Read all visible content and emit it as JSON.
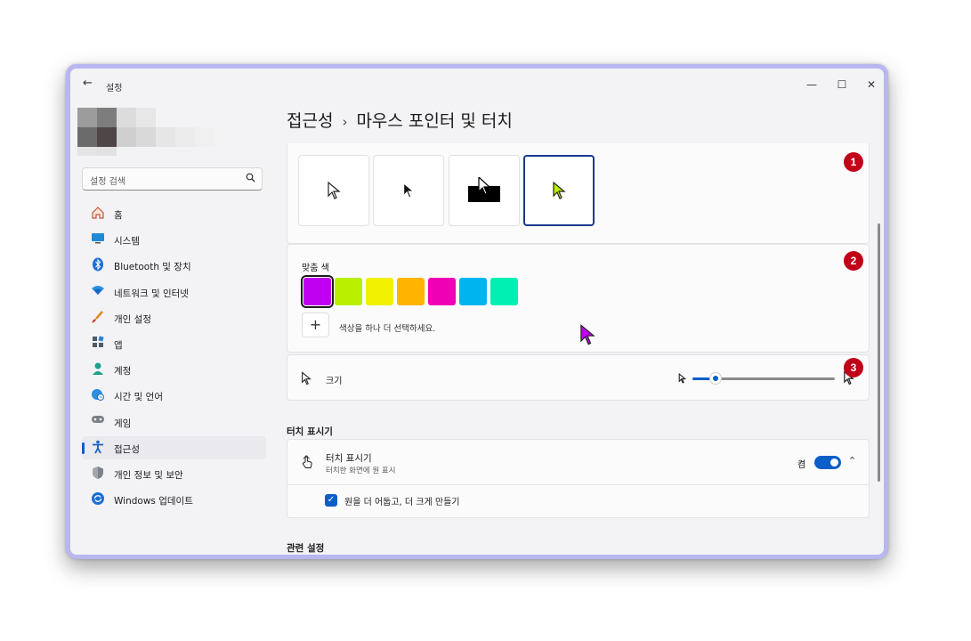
{
  "titlebar": {
    "app_title": "설정",
    "back_icon": "arrow-left-icon",
    "minimize": "—",
    "maximize": "☐",
    "close": "✕"
  },
  "sidebar": {
    "search_placeholder": "설정 검색",
    "items": [
      {
        "label": "홈",
        "icon": "home-icon"
      },
      {
        "label": "시스템",
        "icon": "monitor-icon"
      },
      {
        "label": "Bluetooth 및 장치",
        "icon": "bluetooth-icon"
      },
      {
        "label": "네트워크 및 인터넷",
        "icon": "wifi-icon"
      },
      {
        "label": "개인 설정",
        "icon": "brush-icon"
      },
      {
        "label": "앱",
        "icon": "apps-icon"
      },
      {
        "label": "계정",
        "icon": "person-icon"
      },
      {
        "label": "시간 및 언어",
        "icon": "globe-clock-icon"
      },
      {
        "label": "게임",
        "icon": "gamepad-icon"
      },
      {
        "label": "접근성",
        "icon": "accessibility-icon",
        "active": true
      },
      {
        "label": "개인 정보 및 보안",
        "icon": "shield-icon"
      },
      {
        "label": "Windows 업데이트",
        "icon": "update-icon"
      }
    ]
  },
  "breadcrumb": {
    "parent": "접근성",
    "separator": "›",
    "current": "마우스 포인터 및 터치"
  },
  "pointer_styles": {
    "options": [
      "white",
      "black",
      "inverted",
      "custom"
    ],
    "selected": "custom"
  },
  "custom_color": {
    "label": "맞춤 색",
    "swatches": [
      "#c000f0",
      "#b8f000",
      "#f0f000",
      "#ffb400",
      "#f000b4",
      "#00b4f0",
      "#00f0b4"
    ],
    "selected_index": 0,
    "add_label": "+",
    "add_hint": "색상을 하나 더 선택하세요."
  },
  "size": {
    "label": "크기",
    "value_fraction": 0.15
  },
  "touch": {
    "section_heading": "터치 표시기",
    "title": "터치 표시기",
    "subtitle": "터치한 화면에 원 표시",
    "state_label": "켬",
    "toggle_on": true,
    "checkbox_label": "원을 더 어둡고, 더 크게 만들기",
    "checkbox_checked": true
  },
  "related": {
    "heading": "관련 설정"
  },
  "annotations": [
    "1",
    "2",
    "3"
  ],
  "colors": {
    "accent": "#0a5ec7",
    "badge": "#c00018",
    "window_border": "#b9b6f0"
  }
}
